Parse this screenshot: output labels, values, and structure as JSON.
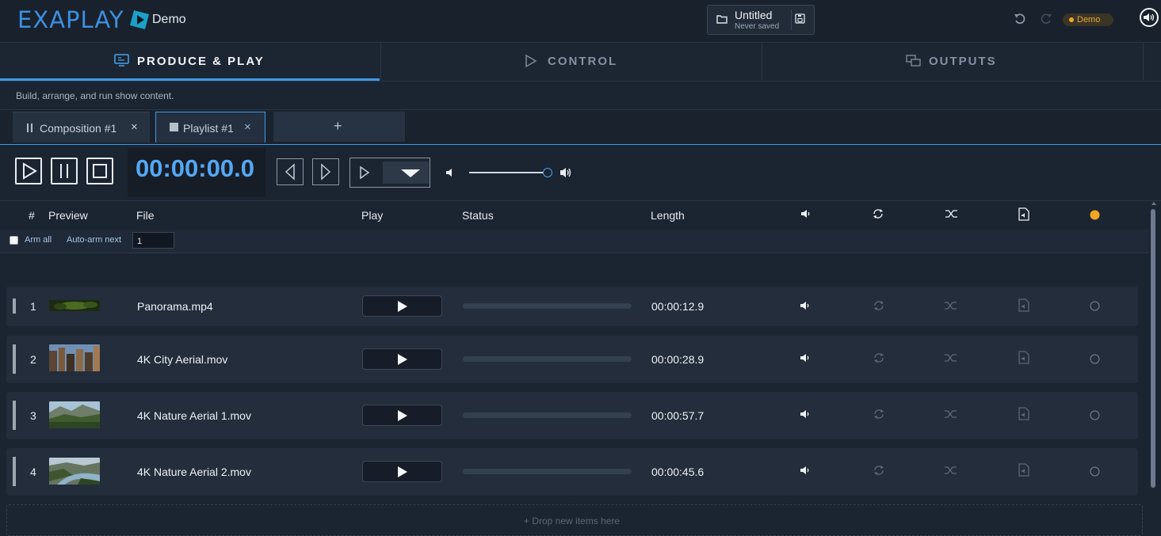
{
  "app": {
    "logo": "EXAPLAY",
    "edition": "Demo"
  },
  "project": {
    "title": "Untitled",
    "save_state": "Never saved"
  },
  "topbar": {
    "license_badge": "Demo"
  },
  "nav_tabs": [
    {
      "label": "PRODUCE & PLAY",
      "active": true
    },
    {
      "label": "CONTROL",
      "active": false
    },
    {
      "label": "OUTPUTS",
      "active": false
    }
  ],
  "subtitle": "Build, arrange, and run show content.",
  "doc_tabs": [
    {
      "label": "Composition #1",
      "close": "×"
    },
    {
      "label": "Playlist #1",
      "close": "×"
    }
  ],
  "add_tab_label": "+",
  "transport": {
    "timecode": "00:00:00.0",
    "volume_level": 1.0
  },
  "table": {
    "headers": {
      "num": "#",
      "preview": "Preview",
      "file": "File",
      "play": "Play",
      "status": "Status",
      "length": "Length"
    },
    "arm_all_label": "Arm all",
    "auto_arm_label": "Auto-arm next",
    "auto_arm_value": "1",
    "header_status_color": "#f2a624",
    "rows": [
      {
        "num": "1",
        "file": "Panorama.mp4",
        "length": "00:00:12.9",
        "progress": 0
      },
      {
        "num": "2",
        "file": "4K City Aerial.mov",
        "length": "00:00:28.9",
        "progress": 0
      },
      {
        "num": "3",
        "file": "4K Nature Aerial 1.mov",
        "length": "00:00:57.7",
        "progress": 0
      },
      {
        "num": "4",
        "file": "4K Nature Aerial 2.mov",
        "length": "00:00:45.6",
        "progress": 0
      }
    ]
  },
  "drop_zone_label": "+ Drop new items here",
  "icons": [
    "folder-icon",
    "save-icon",
    "undo-icon",
    "redo-icon",
    "speaker-icon",
    "monitor-icon",
    "play-icon",
    "outputs-icon",
    "pause-icon",
    "stop-icon",
    "prev-icon",
    "next-icon",
    "dropdown-icon",
    "volume-low-icon",
    "volume-high-icon",
    "loop-icon",
    "shuffle-icon",
    "file-audio-icon",
    "status-dot-icon"
  ]
}
